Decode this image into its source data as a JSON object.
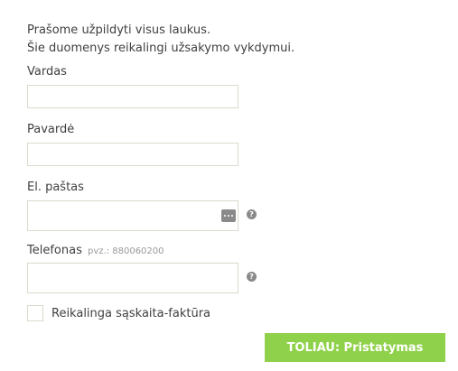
{
  "intro": {
    "line1": "Prašome užpildyti visus laukus.",
    "line2": "Šie duomenys reikalingi užsakymo vykdymui."
  },
  "fields": {
    "first_name": {
      "label": "Vardas",
      "value": ""
    },
    "last_name": {
      "label": "Pavardė",
      "value": ""
    },
    "email": {
      "label": "El. paštas",
      "value": "",
      "icon": "dots-icon",
      "help_icon": "help-icon"
    },
    "phone": {
      "label": "Telefonas",
      "hint": "pvz.: 880060200",
      "value": "",
      "help_icon": "help-icon"
    }
  },
  "invoice": {
    "label": "Reikalinga sąskaita-faktūra",
    "checked": false
  },
  "next_button": {
    "label": "TOLIAU: Pristatymas"
  },
  "colors": {
    "accent": "#8fd14a",
    "field_border": "#d8dccc",
    "text": "#404040",
    "icon": "#8a8a8a"
  }
}
